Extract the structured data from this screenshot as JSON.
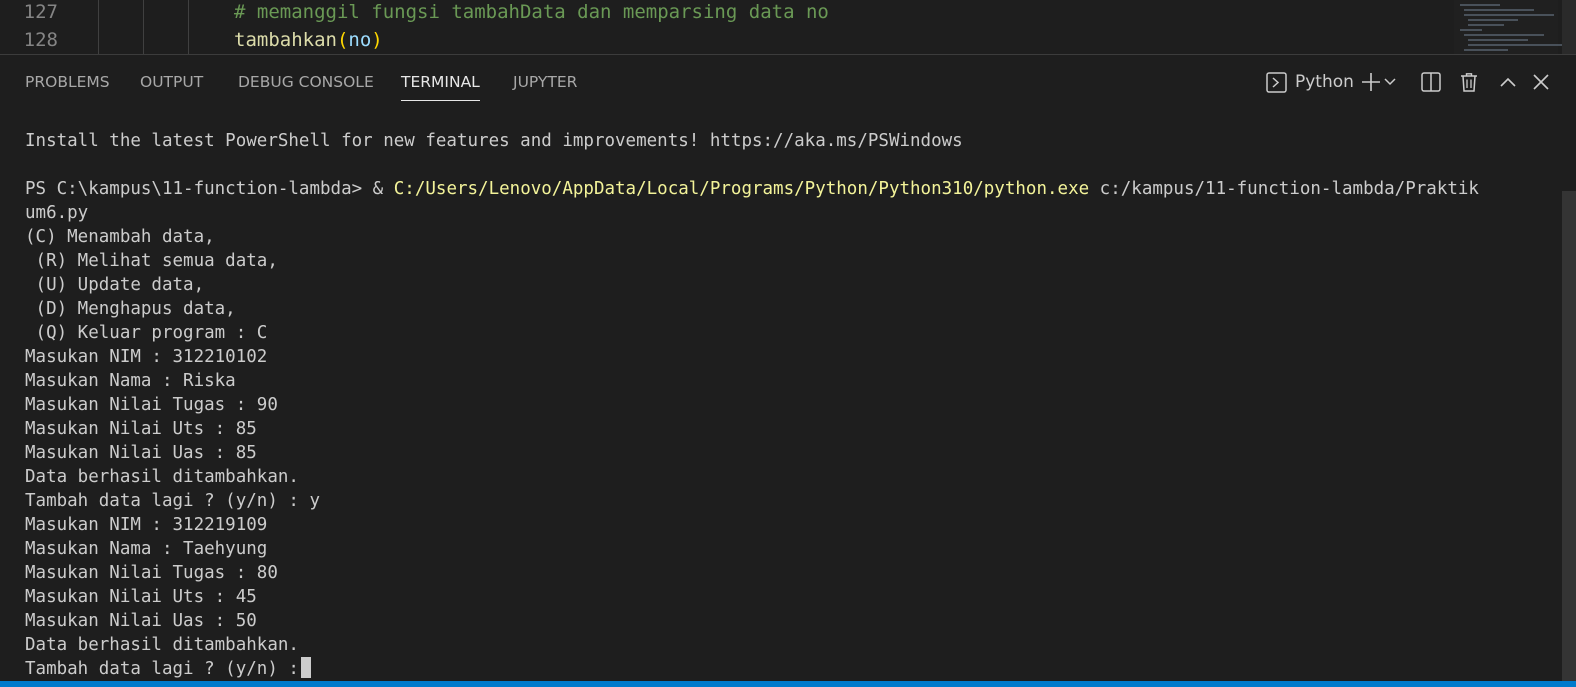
{
  "editor": {
    "lines": [
      {
        "number": "127",
        "code": "# memanggil fungsi tambahData dan memparsing data no"
      },
      {
        "number": "128",
        "func": "tambahkan",
        "open_paren": "(",
        "arg": "no",
        "close_paren": ")"
      }
    ]
  },
  "panel": {
    "tabs": [
      {
        "label": "PROBLEMS",
        "active": false
      },
      {
        "label": "OUTPUT",
        "active": false
      },
      {
        "label": "DEBUG CONSOLE",
        "active": false
      },
      {
        "label": "TERMINAL",
        "active": true
      },
      {
        "label": "JUPYTER",
        "active": false
      }
    ],
    "terminal_profile": "Python",
    "controls": [
      "new-terminal-icon",
      "chevron-down-icon",
      "split-terminal-icon",
      "trash-icon",
      "chevron-up-icon",
      "close-icon"
    ]
  },
  "terminal": {
    "install_message": "Install the latest PowerShell for new features and improvements! https://aka.ms/PSWindows",
    "prompt": "PS C:\\kampus\\11-function-lambda> & ",
    "python_path": "C:/Users/Lenovo/AppData/Local/Programs/Python/Python310/python.exe",
    "script_arg": " c:/kampus/11-function-lambda/Praktik",
    "script_arg_wrap": "um6.py",
    "output_lines": [
      "(C) Menambah data,",
      " (R) Melihat semua data,",
      " (U) Update data,",
      " (D) Menghapus data,",
      " (Q) Keluar program : C",
      "Masukan NIM : 312210102",
      "Masukan Nama : Riska",
      "Masukan Nilai Tugas : 90",
      "Masukan Nilai Uts : 85",
      "Masukan Nilai Uas : 85",
      "Data berhasil ditambahkan.",
      "Tambah data lagi ? (y/n) : y",
      "Masukan NIM : 312219109",
      "Masukan Nama : Taehyung",
      "Masukan Nilai Tugas : 80",
      "Masukan Nilai Uts : 45",
      "Masukan Nilai Uas : 50",
      "Data berhasil ditambahkan."
    ],
    "current_input": "Tambah data lagi ? (y/n) :"
  },
  "colors": {
    "background": "#1e1e1e",
    "text": "#cccccc",
    "path_highlight": "#f3f399",
    "comment": "#6a9955",
    "function": "#dcdcaa",
    "accent": "#007acc"
  }
}
